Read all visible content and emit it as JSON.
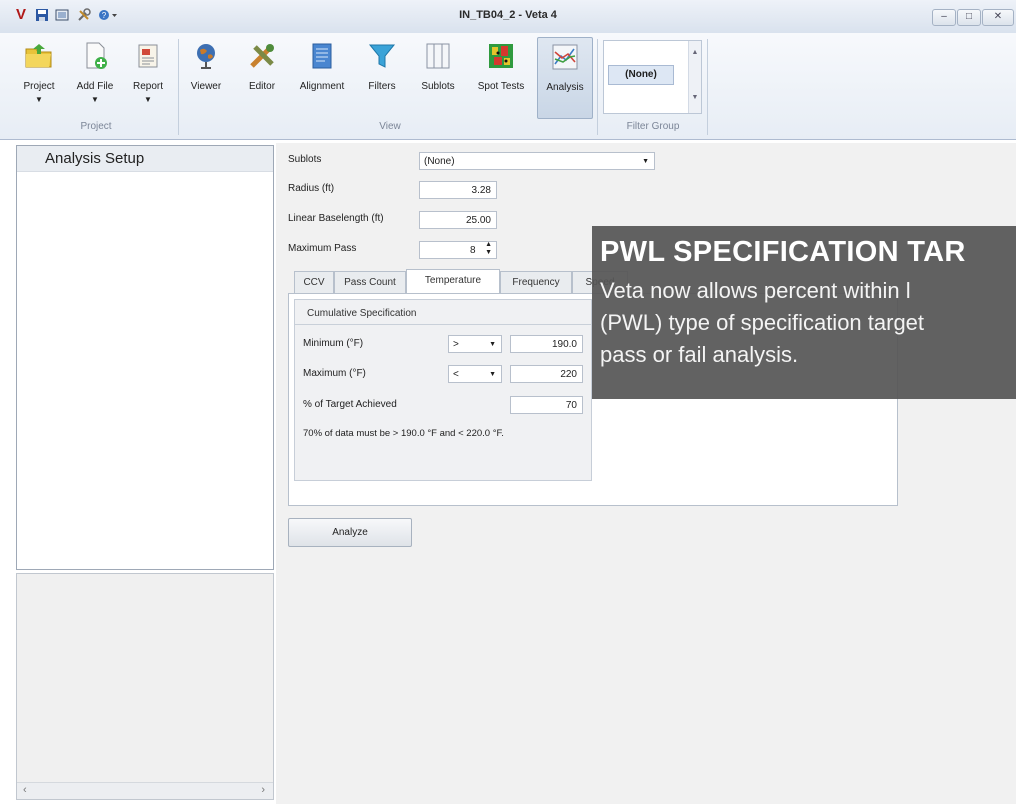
{
  "window": {
    "title": "IN_TB04_2 - Veta 4",
    "controls": [
      "–",
      "□",
      "✕"
    ]
  },
  "quick_access": {
    "app_letter": "V"
  },
  "ribbon": {
    "project_group": {
      "label": "Project",
      "buttons": [
        "Project",
        "Add File",
        "Report"
      ]
    },
    "view_group": {
      "label": "View",
      "buttons": [
        "Viewer",
        "Editor",
        "Alignment",
        "Filters",
        "Sublots",
        "Spot Tests",
        "Analysis"
      ]
    },
    "filter_group": {
      "label": "Filter Group",
      "selected": "(None)"
    }
  },
  "left_panel": {
    "title": "Analysis Setup",
    "scroll_left": "‹",
    "scroll_right": "›"
  },
  "form": {
    "sublots_label": "Sublots",
    "sublots_value": "(None)",
    "radius_label": "Radius (ft)",
    "radius_value": "3.28",
    "baselength_label": "Linear Baselength (ft)",
    "baselength_value": "25.00",
    "max_pass_label": "Maximum Pass",
    "max_pass_value": "8"
  },
  "tabs": [
    "CCV",
    "Pass Count",
    "Temperature",
    "Frequency",
    "Speed"
  ],
  "selected_tab": "Temperature",
  "spec": {
    "group_title": "Cumulative Specification",
    "min_label": "Minimum (°F)",
    "min_op": ">",
    "min_value": "190.0",
    "max_label": "Maximum (°F)",
    "max_op": "<",
    "max_value": "220",
    "pct_label": "% of Target Achieved",
    "pct_value": "70",
    "summary": "70% of data must be > 190.0 °F and < 220.0 °F."
  },
  "analyze_label": "Analyze",
  "overlay": {
    "title": "PWL SPECIFICATION TAR",
    "lines": [
      "Veta now allows percent within l",
      "(PWL) type of specification target",
      "pass or fail analysis."
    ]
  },
  "colors": {
    "overlay_bg": "#555555",
    "ribbon_bg": "#e7edf5",
    "accent": "#2f6fb7"
  }
}
